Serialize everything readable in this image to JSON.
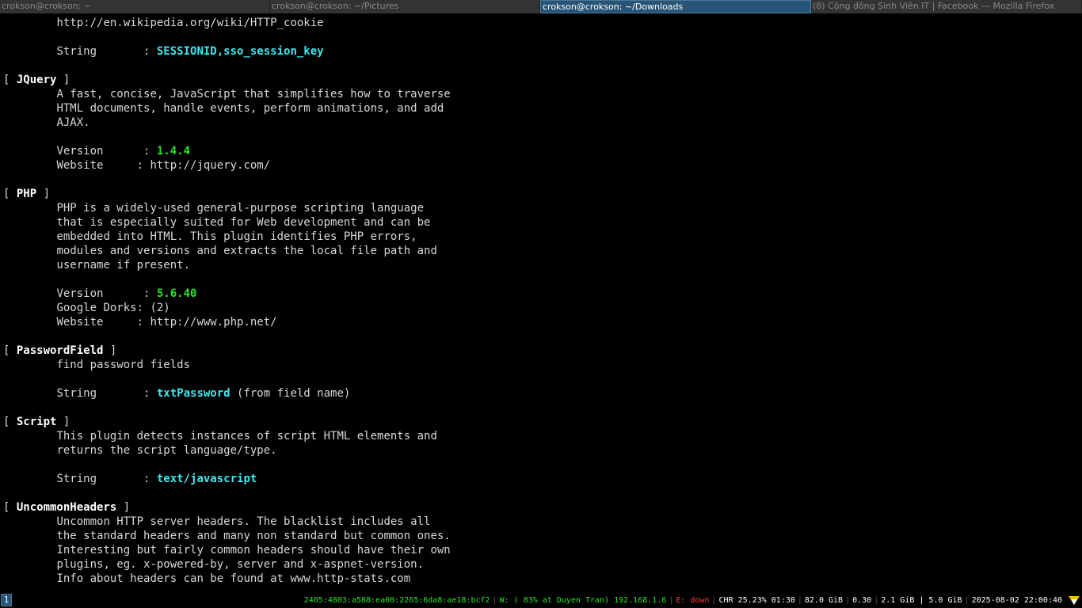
{
  "titlebar": {
    "tabs": [
      {
        "label": "crokson@crokson: ~",
        "active": false
      },
      {
        "label": "crokson@crokson: ~/Pictures",
        "active": false
      },
      {
        "label": "crokson@crokson: ~/Downloads",
        "active": true
      },
      {
        "label": "(8) Cộng đồng Sinh Viên IT | Facebook — Mozilla Firefox",
        "active": false
      }
    ]
  },
  "terminal": {
    "cookie_url": "http://en.wikipedia.org/wiki/HTTP_cookie",
    "cookie_string_label": "String       : ",
    "cookie_string_value": "SESSIONID,sso_session_key",
    "plugins": {
      "jquery": {
        "name": "JQuery",
        "desc": [
          "A fast, concise, JavaScript that simplifies how to traverse",
          "HTML documents, handle events, perform animations, and add",
          "AJAX."
        ],
        "version_label": "Version      : ",
        "version_value": "1.4.4",
        "website": "Website     : http://jquery.com/"
      },
      "php": {
        "name": "PHP",
        "desc": [
          "PHP is a widely-used general-purpose scripting language",
          "that is especially suited for Web development and can be",
          "embedded into HTML. This plugin identifies PHP errors,",
          "modules and versions and extracts the local file path and",
          "username if present."
        ],
        "version_label": "Version      : ",
        "version_value": "5.6.40",
        "dorks": "Google Dorks: (2)",
        "website": "Website     : http://www.php.net/"
      },
      "passwordfield": {
        "name": "PasswordField",
        "desc": [
          "find password fields"
        ],
        "string_label": "String       : ",
        "string_value": "txtPassword",
        "string_suffix": " (from field name)"
      },
      "script": {
        "name": "Script",
        "desc": [
          "This plugin detects instances of script HTML elements and",
          "returns the script language/type."
        ],
        "string_label": "String       : ",
        "string_value": "text/javascript"
      },
      "uncommonheaders": {
        "name": "UncommonHeaders",
        "desc": [
          "Uncommon HTTP server headers. The blacklist includes all",
          "the standard headers and many non standard but common ones.",
          "Interesting but fairly common headers should have their own",
          "plugins, eg. x-powered-by, server and x-aspnet-version.",
          "Info about headers can be found at www.http-stats.com"
        ]
      }
    }
  },
  "statusbar": {
    "workspace": "1",
    "ipv6": "2405:4803:a588:ea00:2265:6da8:ae18:bcf2",
    "wifi": "W: ( 83% at Duyen Tran) 192.168.1.6",
    "ethernet": "E: down",
    "battery": "CHR 25.23% 01:30",
    "disk": "82.0 GiB",
    "load": "0.30",
    "memory": "2.1 GiB | 5.0 GiB",
    "datetime": "2025-08-02 22:00:40"
  },
  "colors": {
    "active_tab_bg": "#285577",
    "cyan_value": "#3ee8f0",
    "green_value": "#27e527",
    "status_red": "#ff3b3b"
  },
  "icons": {
    "tray": "network-tray-icon"
  }
}
